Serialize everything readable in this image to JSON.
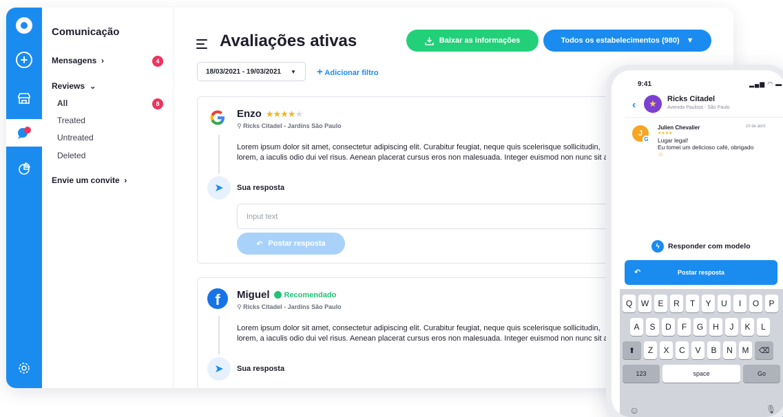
{
  "sidebar": {
    "title": "Comunicação",
    "items": [
      {
        "label": "Mensagens",
        "badge": "4"
      },
      {
        "label": "Reviews"
      },
      {
        "label": "All",
        "badge": "8"
      },
      {
        "label": "Treated"
      },
      {
        "label": "Untreated"
      },
      {
        "label": "Deleted"
      },
      {
        "label": "Envie um convite"
      }
    ]
  },
  "header": {
    "title": "Avaliações ativas",
    "download_label": "Baixar as informações",
    "establishments_label": "Todos os estabelecimentos (980)"
  },
  "filters": {
    "date_range": "18/03/2021 - 19/03/2021",
    "add_filter": "Adicionar filtro"
  },
  "reviews": [
    {
      "source": "google",
      "author": "Enzo",
      "stars": 4,
      "location": "Ricks Citadel - Jardins São Paulo",
      "text_line1": "Lorem ipsum dolor sit amet, consectetur adipiscing elit. Curabitur feugiat, neque quis scelerisque sollicitudin,",
      "text_line2": "lorem, a iaculis odio dui vel risus. Aenean placerat cursus eros non malesuada. Integer euismod non nunc sit a",
      "response_label": "Sua resposta",
      "input_placeholder": "Input text",
      "post_label": "Postar resposta"
    },
    {
      "source": "facebook",
      "author": "Miguel",
      "recommended": "Recomendado",
      "location": "Ricks Citadel - Jardins São Paulo",
      "text_line1": "Lorem ipsum dolor sit amet, consectetur adipiscing elit. Curabitur feugiat, neque quis scelerisque sollicitudin,",
      "text_line2": "lorem, a iaculis odio dui vel risus. Aenean placerat cursus eros non malesuada. Integer euismod non nunc sit a",
      "response_label": "Sua resposta"
    }
  ],
  "phone": {
    "time": "9:41",
    "place_name": "Ricks Citadel",
    "place_address": "Avenida Paulista - São Paulo",
    "message": {
      "avatar_letter": "J",
      "author": "Julien Chevalier",
      "date": "10 de abril",
      "stars": 4,
      "line1": "Lugar legal!",
      "line2": "Eu tomei um delicioso café, obrigado"
    },
    "template_label": "Responder com modelo",
    "post_label": "Postar resposta",
    "keyboard": {
      "row1": [
        "Q",
        "W",
        "E",
        "R",
        "T",
        "Y",
        "U",
        "I",
        "O",
        "P"
      ],
      "row2": [
        "A",
        "S",
        "D",
        "F",
        "G",
        "H",
        "J",
        "K",
        "L"
      ],
      "row3": [
        "Z",
        "X",
        "C",
        "V",
        "B",
        "N",
        "M"
      ],
      "numbers": "123",
      "space": "space",
      "go": "Go"
    }
  },
  "icons": {
    "logo": "logo-icon",
    "add": "plus-icon",
    "store": "store-icon",
    "chat": "chat-icon",
    "analytics": "pie-chart-icon",
    "settings": "gear-icon",
    "menu": "hamburger-icon",
    "download": "download-icon",
    "dropdown": "chevron-down-icon",
    "send": "send-icon",
    "reply": "reply-icon",
    "bolt": "bolt-icon"
  },
  "colors": {
    "primary": "#1a8cf0",
    "success": "#23d07a",
    "badge": "#f0335c",
    "star": "#f5b51f"
  }
}
